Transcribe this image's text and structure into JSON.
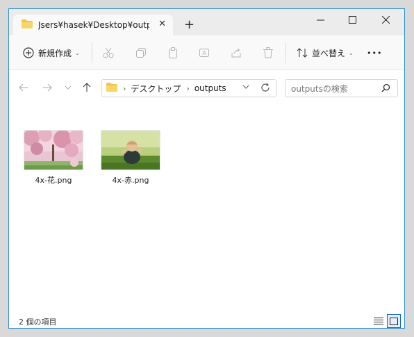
{
  "window": {
    "tab_title": "Jsers¥hasek¥Desktop¥outputs",
    "close_tab_glyph": "✕",
    "new_tab_glyph": "+",
    "minimize_glyph": "─",
    "maximize_glyph": "☐",
    "close_glyph": "✕"
  },
  "toolbar": {
    "new_label": "新規作成",
    "sort_label": "並べ替え",
    "more_glyph": "•••",
    "chevron": "⌄"
  },
  "address": {
    "crumbs": [
      "デスクトップ",
      "outputs"
    ],
    "separator": "›",
    "search_placeholder": "outputsの検索"
  },
  "files": [
    {
      "name": "4x-花.png",
      "thumb": "cherry-blossom"
    },
    {
      "name": "4x-赤.png",
      "thumb": "baby-on-grass"
    }
  ],
  "status": {
    "item_count": "2 個の項目"
  },
  "colors": {
    "accent": "#0a64c8",
    "folder": "#f3c443"
  }
}
